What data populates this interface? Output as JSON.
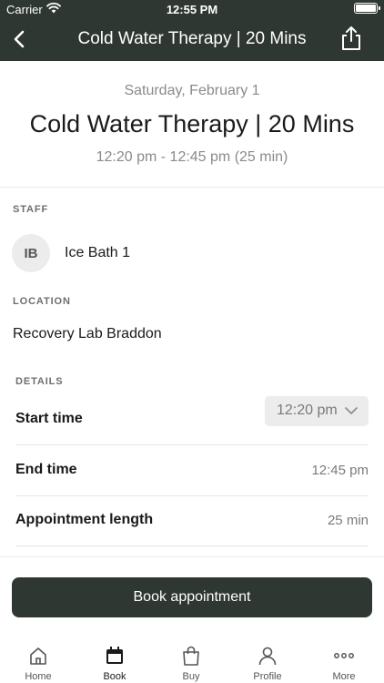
{
  "status_bar": {
    "carrier": "Carrier",
    "time": "12:55 PM"
  },
  "nav": {
    "title": "Cold Water Therapy | 20 Mins",
    "back_icon": "chevron-left-icon",
    "share_icon": "share-icon"
  },
  "header": {
    "date": "Saturday, February 1",
    "title": "Cold Water Therapy | 20 Mins",
    "time_range": "12:20 pm - 12:45 pm (25 min)"
  },
  "staff": {
    "label": "STAFF",
    "initials": "IB",
    "name": "Ice Bath 1"
  },
  "location": {
    "label": "LOCATION",
    "name": "Recovery Lab Braddon"
  },
  "details": {
    "label": "DETAILS",
    "start_time_label": "Start time",
    "start_time_value": "12:20 pm",
    "end_time_label": "End time",
    "end_time_value": "12:45 pm",
    "length_label": "Appointment length",
    "length_value": "25 min"
  },
  "book_button": "Book appointment",
  "tabs": [
    {
      "label": "Home",
      "icon": "home-icon"
    },
    {
      "label": "Book",
      "icon": "calendar-icon",
      "active": true
    },
    {
      "label": "Buy",
      "icon": "shopping-bag-icon"
    },
    {
      "label": "Profile",
      "icon": "profile-icon"
    },
    {
      "label": "More",
      "icon": "more-icon"
    }
  ],
  "colors": {
    "brand": "#2f3732",
    "muted": "#8a8a8a"
  }
}
